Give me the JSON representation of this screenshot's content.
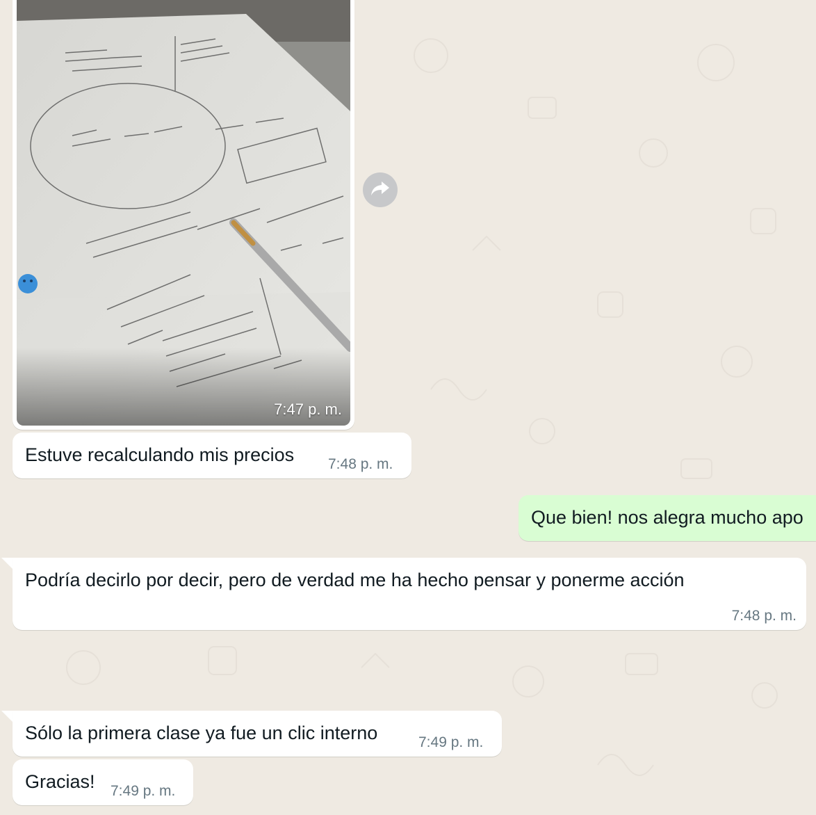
{
  "messages": [
    {
      "id": "m1",
      "type": "image",
      "direction": "in",
      "time": "7:47 p. m."
    },
    {
      "id": "m2",
      "type": "text",
      "direction": "in",
      "text": "Estuve recalculando mis precios",
      "time": "7:48 p. m."
    },
    {
      "id": "m3",
      "type": "text",
      "direction": "out",
      "text": "Que bien! nos alegra mucho apo"
    },
    {
      "id": "m4",
      "type": "text",
      "direction": "in",
      "text": "Podría decirlo por decir, pero de verdad me ha hecho pensar y ponerme acción",
      "time": "7:48 p. m."
    },
    {
      "id": "m5",
      "type": "text",
      "direction": "in",
      "text": "Sólo la primera clase ya fue un clic interno",
      "time": "7:49 p. m."
    },
    {
      "id": "m6",
      "type": "text",
      "direction": "in",
      "text": "Gracias!",
      "time": "7:49 p. m."
    }
  ],
  "icons": {
    "forward": "forward-icon"
  },
  "colors": {
    "chat_background": "#efeae2",
    "incoming_bubble": "#ffffff",
    "outgoing_bubble": "#d9fdd3",
    "timestamp": "#667781"
  }
}
